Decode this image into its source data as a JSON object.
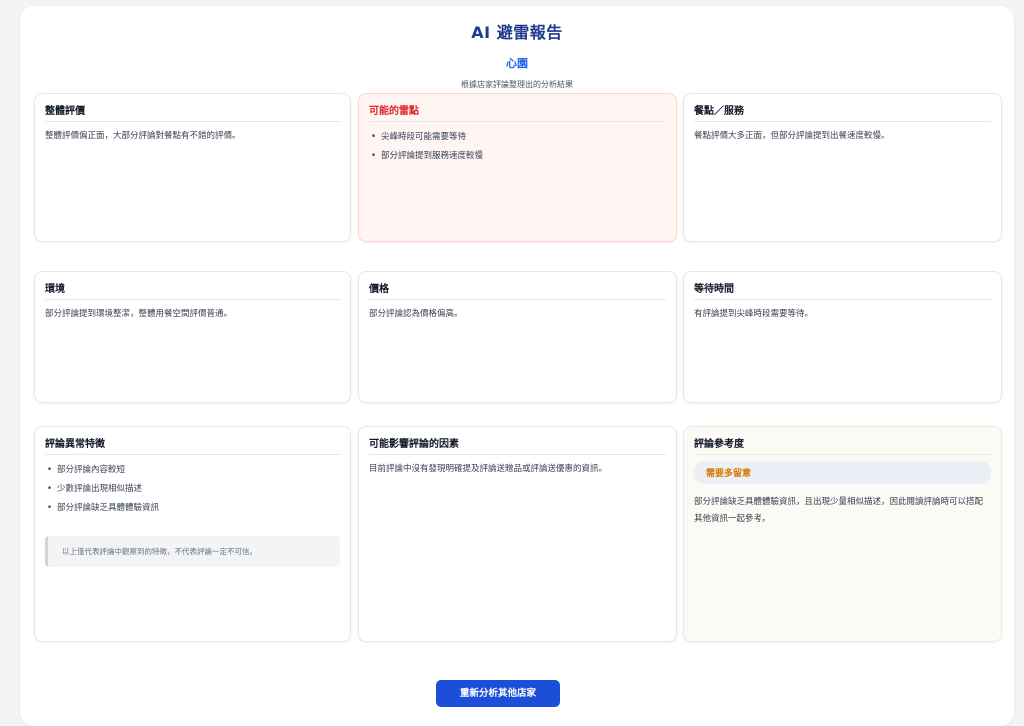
{
  "header": {
    "title": "AI 避雷報告",
    "store_name": "心園",
    "subtitle": "根據店家評論整理出的分析結果"
  },
  "cards": {
    "overall": {
      "title": "整體評價",
      "text": "整體評價偏正面，大部分評論對餐點有不錯的評價。"
    },
    "pitfalls": {
      "title": "可能的雷點",
      "items": [
        "尖峰時段可能需要等待",
        "部分評論提到服務速度較慢"
      ]
    },
    "food_service": {
      "title": "餐點／服務",
      "text": "餐點評價大多正面，但部分評論提到出餐速度較慢。"
    },
    "environment": {
      "title": "環境",
      "text": "部分評論提到環境整潔，整體用餐空間評價普通。"
    },
    "price": {
      "title": "價格",
      "text": "部分評論認為價格偏高。"
    },
    "wait_time": {
      "title": "等待時間",
      "text": "有評論提到尖峰時段需要等待。"
    },
    "anomalies": {
      "title": "評論異常特徵",
      "items": [
        "部分評論內容較短",
        "少數評論出現相似描述",
        "部分評論缺乏具體體驗資訊"
      ],
      "note": "以上僅代表評論中觀察到的特徵，不代表評論一定不可信。"
    },
    "factors": {
      "title": "可能影響評論的因素",
      "text": "目前評論中沒有發現明確提及評論送贈品或評論送優惠的資訊。"
    },
    "reference": {
      "title": "評論參考度",
      "badge": "需要多留意",
      "text": "部分評論缺乏具體體驗資訊，且出現少量相似描述，因此閱讀評論時可以搭配其他資訊一起參考。"
    }
  },
  "actions": {
    "reanalyze_label": "重新分析其他店家"
  },
  "colors": {
    "accent": "#1d4ed8",
    "warning": "#dc2626",
    "badge": "#d97706"
  }
}
